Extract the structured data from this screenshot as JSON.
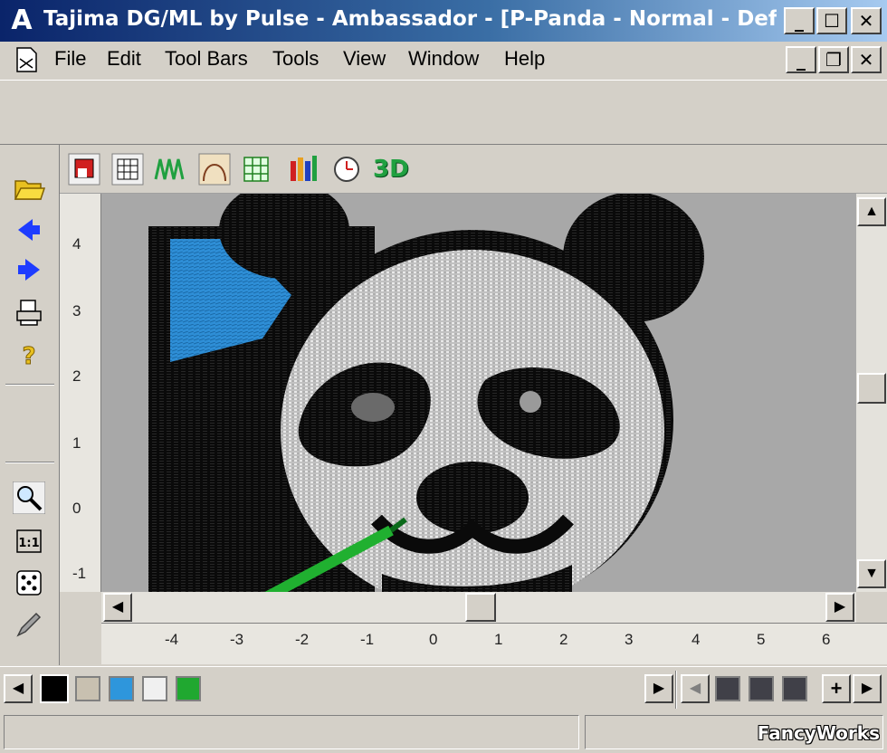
{
  "window": {
    "title": "Tajima DG/ML by Pulse - Ambassador - [P-Panda - Normal - Defaul...",
    "minimize": "_",
    "maximize": "☐",
    "close": "✕"
  },
  "menu": {
    "items": [
      "File",
      "Edit",
      "Tool Bars",
      "Tools",
      "View",
      "Window",
      "Help"
    ],
    "mdi_minimize": "_",
    "mdi_restore": "❐",
    "mdi_close": "✕"
  },
  "left_tools": [
    "open-folder-icon",
    "back-arrow-icon",
    "forward-arrow-icon",
    "print-icon",
    "help-icon",
    "zoom-icon",
    "actual-size-icon",
    "dice-icon",
    "pencil-icon"
  ],
  "view_tools": [
    "stitch-view-icon",
    "grid-view-icon",
    "stitch-lines-icon",
    "outline-icon",
    "table-icon",
    "color-bars-icon",
    "clock-icon",
    "3d-icon"
  ],
  "view_tools_3d_label": "3D",
  "ruler": {
    "vertical": [
      "4",
      "3",
      "2",
      "1",
      "0",
      "-1"
    ],
    "horizontal": [
      "-4",
      "-3",
      "-2",
      "-1",
      "0",
      "1",
      "2",
      "3",
      "4",
      "5",
      "6"
    ]
  },
  "palette": {
    "colors": [
      "#000000",
      "#c8c0b0",
      "#2e96dc",
      "#f0f0f0",
      "#20a830"
    ],
    "right_colors": [
      "#404048",
      "#404048",
      "#404048"
    ],
    "add_button": "+"
  },
  "scroll": {
    "up": "▲",
    "down": "▼",
    "left": "◀",
    "right": "▶"
  },
  "watermark": "FancyWorks"
}
